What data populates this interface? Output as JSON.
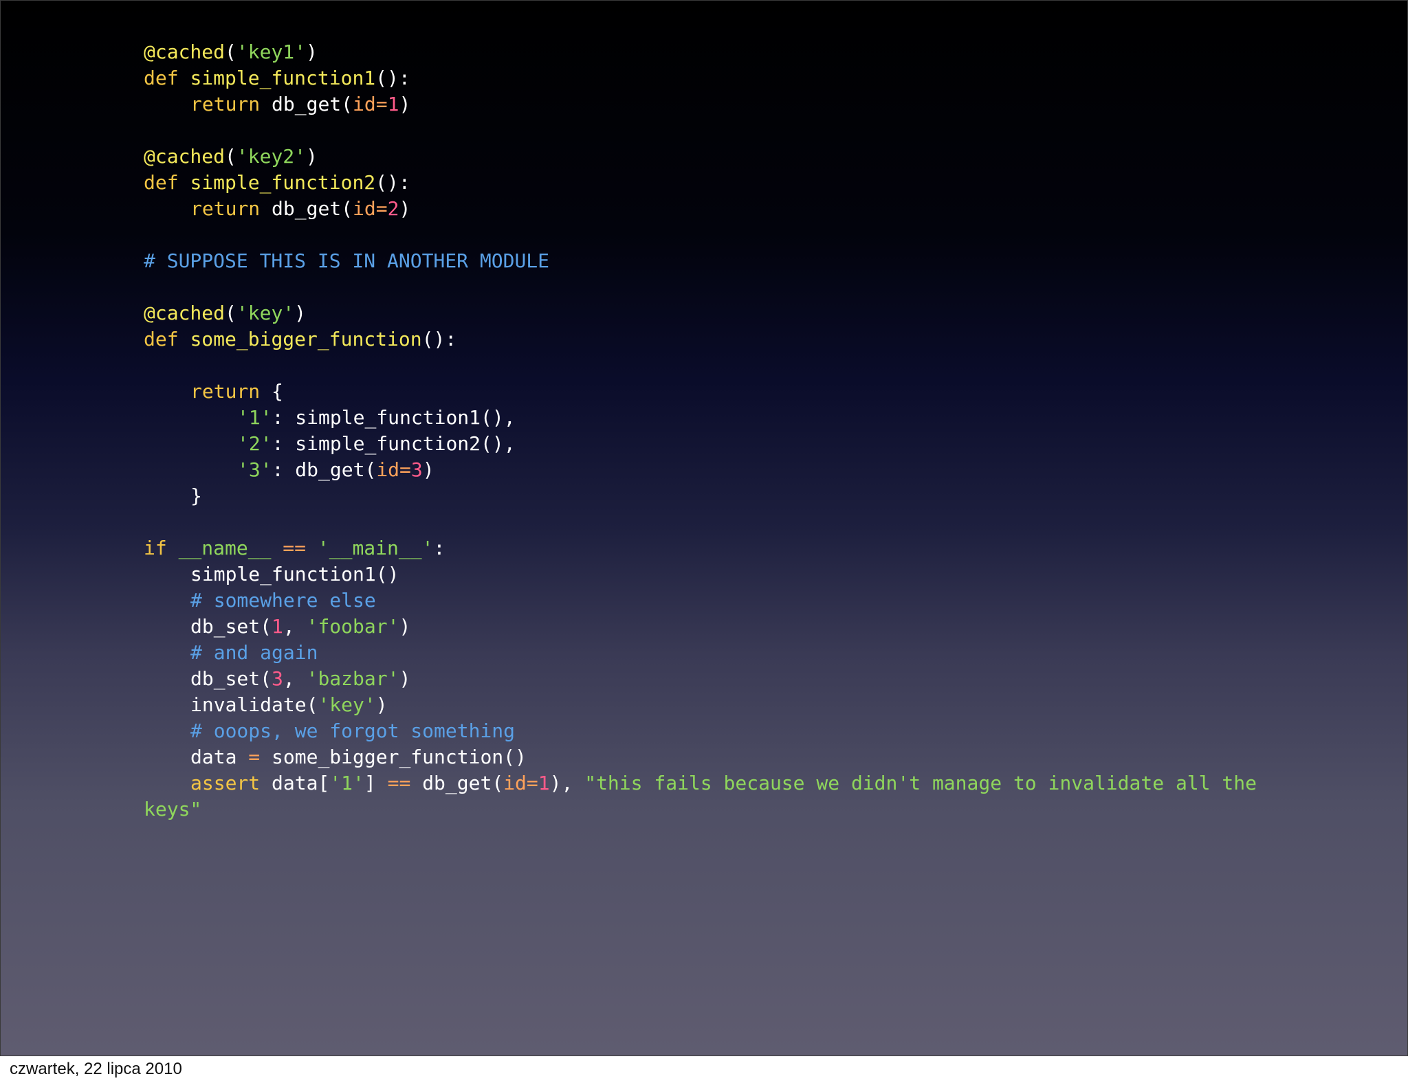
{
  "code": {
    "decorator_1": "@cached",
    "key1_arg": "'key1'",
    "def_1_kw": "def",
    "fn_1": "simple_function1",
    "return_1_kw": "return",
    "db_get": "db_get",
    "id_kwarg": "id=",
    "num_1": "1",
    "decorator_2": "@cached",
    "key2_arg": "'key2'",
    "def_2_kw": "def",
    "fn_2": "simple_function2",
    "return_2_kw": "return",
    "num_2": "2",
    "comment_module": "# SUPPOSE THIS IS IN ANOTHER MODULE",
    "decorator_3": "@cached",
    "key_arg": "'key'",
    "def_3_kw": "def",
    "fn_3": "some_bigger_function",
    "return_3_kw": "return",
    "dict_key_1": "'1'",
    "dict_val_1": "simple_function1(),",
    "dict_key_2": "'2'",
    "dict_val_2": "simple_function2(),",
    "dict_key_3": "'3'",
    "num_3": "3",
    "if_kw": "if",
    "name_var": "__name__",
    "eq_op": "==",
    "main_str": "'__main__'",
    "call_fn1": "simple_function1()",
    "comment_somewhere": "# somewhere else",
    "db_set": "db_set",
    "foobar_str": "'foobar'",
    "comment_again": "# and again",
    "bazbar_str": "'bazbar'",
    "invalidate": "invalidate",
    "comment_forgot": "# ooops, we forgot something",
    "data_var": "data",
    "assign_op": "=",
    "call_bigger": "some_bigger_function()",
    "assert_kw": "assert",
    "subscript_key": "'1'",
    "assert_msg_line1": "\"this fails because we didn't manage to invalidate all the",
    "assert_msg_line2": "keys\""
  },
  "footer": {
    "date": "czwartek, 22 lipca 2010"
  }
}
